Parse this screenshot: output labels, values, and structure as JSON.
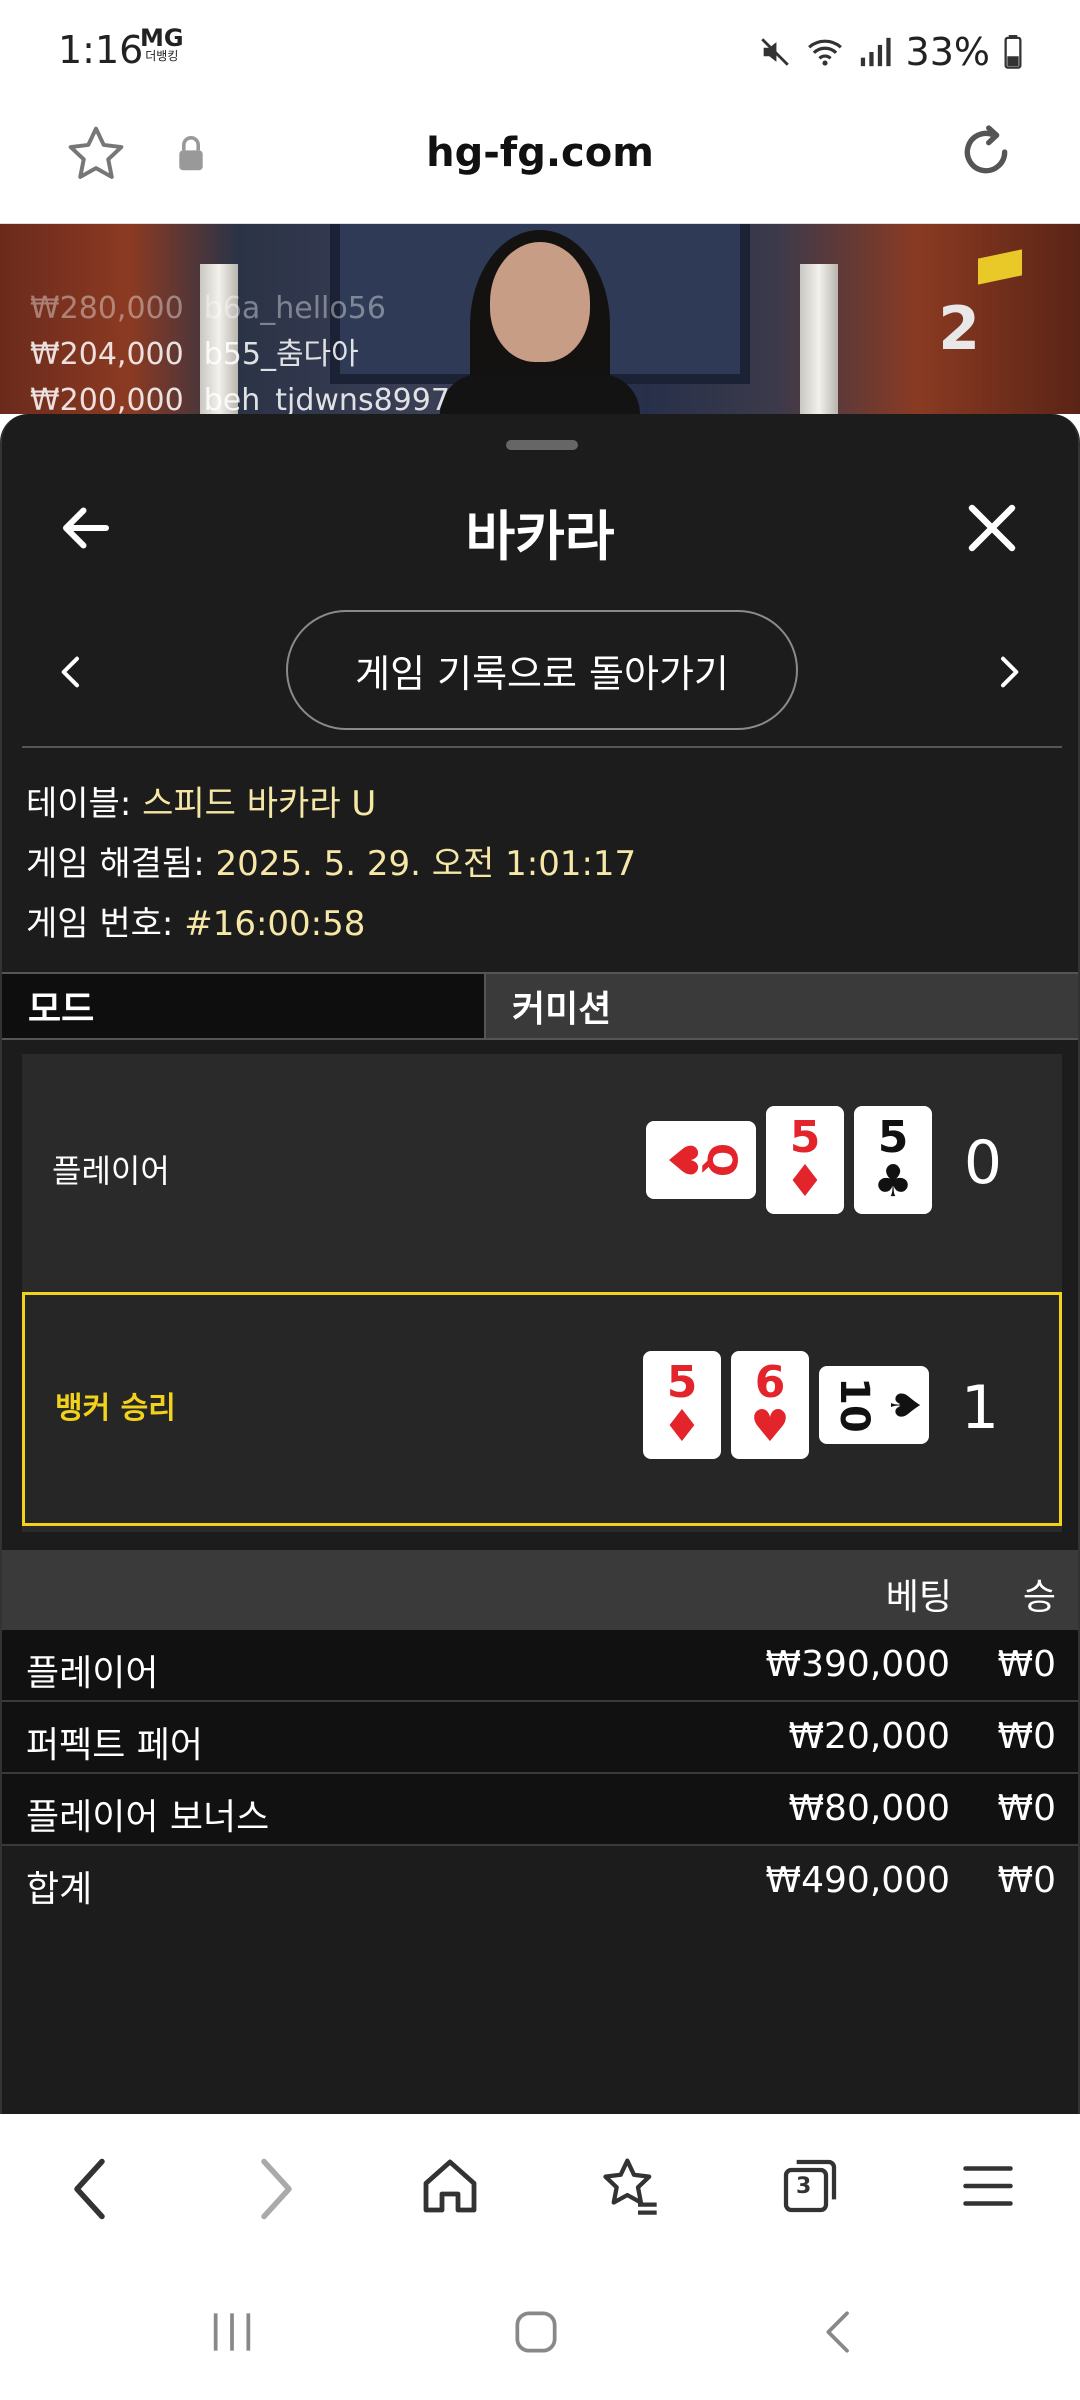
{
  "status_bar": {
    "time": "1:16",
    "carrier_logo": "MG",
    "carrier_sub": "더뱅킹",
    "battery": "33%",
    "icons": [
      "mute-icon",
      "wifi-icon",
      "signal-icon",
      "battery-icon"
    ]
  },
  "browser": {
    "url": "hg-fg.com",
    "icons": [
      "bookmark-star-icon",
      "lock-icon",
      "reload-icon"
    ]
  },
  "video": {
    "bets": [
      {
        "amount": "₩280,000",
        "user": "b6a_hello56"
      },
      {
        "amount": "₩204,000",
        "user": "b55_춤다아"
      },
      {
        "amount": "₩200,000",
        "user": "beh_tjdwns8997"
      }
    ],
    "number": "2"
  },
  "sheet": {
    "title": "바카라",
    "history_button": "게임 기록으로 돌아가기",
    "info": {
      "table_label": "테이블:",
      "table_value": "스피드 바카라 U",
      "resolved_label": "게임 해결됨:",
      "resolved_value": "2025. 5. 29. 오전 1:01:17",
      "game_no_label": "게임 번호:",
      "game_no_value": "#16:00:58"
    },
    "tabs": {
      "mode": "모드",
      "commission": "커미션"
    },
    "player": {
      "label": "플레이어",
      "score": "0",
      "cards": [
        {
          "rank": "Q",
          "suit": "♥",
          "color": "red",
          "sideways": true
        },
        {
          "rank": "5",
          "suit": "♦",
          "color": "red",
          "sideways": false
        },
        {
          "rank": "5",
          "suit": "♣",
          "color": "black",
          "sideways": false
        }
      ]
    },
    "banker": {
      "label": "뱅커 승리",
      "score": "1",
      "cards": [
        {
          "rank": "5",
          "suit": "♦",
          "color": "red",
          "sideways": false
        },
        {
          "rank": "6",
          "suit": "♥",
          "color": "red",
          "sideways": false
        },
        {
          "rank": "10",
          "suit": "♠",
          "color": "black",
          "sideways": true
        }
      ]
    },
    "bets": {
      "header_bet": "베팅",
      "header_win": "승",
      "rows": [
        {
          "name": "플레이어",
          "amount": "₩390,000",
          "win": "₩0"
        },
        {
          "name": "퍼펙트 페어",
          "amount": "₩20,000",
          "win": "₩0"
        },
        {
          "name": "플레이어 보너스",
          "amount": "₩80,000",
          "win": "₩0"
        }
      ],
      "total": {
        "name": "합계",
        "amount": "₩490,000",
        "win": "₩0"
      }
    }
  },
  "toolbar": {
    "icons": [
      "back-icon",
      "forward-icon",
      "home-icon",
      "bookmarks-icon",
      "tabs-icon",
      "menu-icon"
    ],
    "tab_count": "3"
  },
  "system_nav": {
    "icons": [
      "recents-icon",
      "home-circle-icon",
      "system-back-icon"
    ]
  },
  "colors": {
    "sheet_bg": "#1c1c1c",
    "highlight": "#f2d21a",
    "info_value": "#f6e7a6",
    "card_red": "#e3242b"
  }
}
